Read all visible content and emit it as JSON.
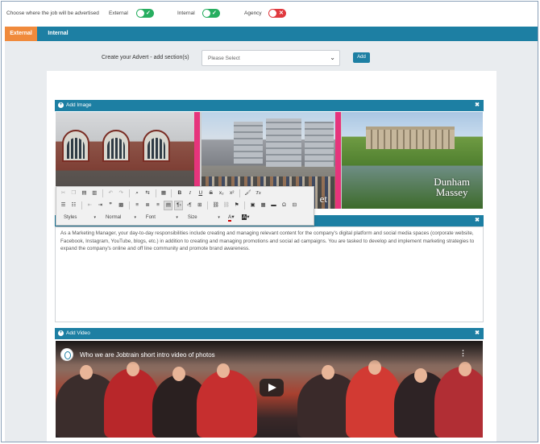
{
  "top_bar": {
    "prompt": "Choose where the job will be advertised",
    "toggles": [
      {
        "label": "External",
        "state": "on",
        "mark": "✓"
      },
      {
        "label": "Internal",
        "state": "on",
        "mark": "✓"
      },
      {
        "label": "Agency",
        "state": "off",
        "mark": "✕"
      }
    ]
  },
  "tabs": {
    "active": "External",
    "items": [
      {
        "label": "External"
      },
      {
        "label": "Internal"
      }
    ]
  },
  "section_picker": {
    "label": "Create your Advert - add section(s)",
    "select_value": "Please Select",
    "add_label": "Add"
  },
  "sections": {
    "image": {
      "title": "Add Image",
      "close": "✖"
    },
    "editor": {
      "close": "✖"
    },
    "video": {
      "title": "Add Video",
      "close": "✖"
    }
  },
  "image_strip": {
    "overlay_text_1": "Dunham",
    "overlay_text_2": "Massey",
    "overlay_partial": "et"
  },
  "toolbar": {
    "combos": [
      "Styles",
      "Normal",
      "Font",
      "Size"
    ]
  },
  "editor_text": "As a Marketing Manager, your day-to-day responsibilities include creating and managing relevant content for the company's digital platform and social media spaces (corporate website, Facebook, Instagram, YouTube, blogs, etc.) in addition to creating and managing promotions and social ad campaigns. You are tasked to develop and implement marketing strategies to expand the company's online and off line community and promote brand awareness.",
  "video": {
    "title": "Who we are Jobtrain short intro video of photos",
    "menu_icon": "⋮"
  },
  "colors": {
    "primary": "#1d7fa3",
    "tab_active": "#f08a3c",
    "toggle_on": "#27ae60",
    "toggle_off": "#e0393e",
    "accent_pink": "#e6347c"
  }
}
